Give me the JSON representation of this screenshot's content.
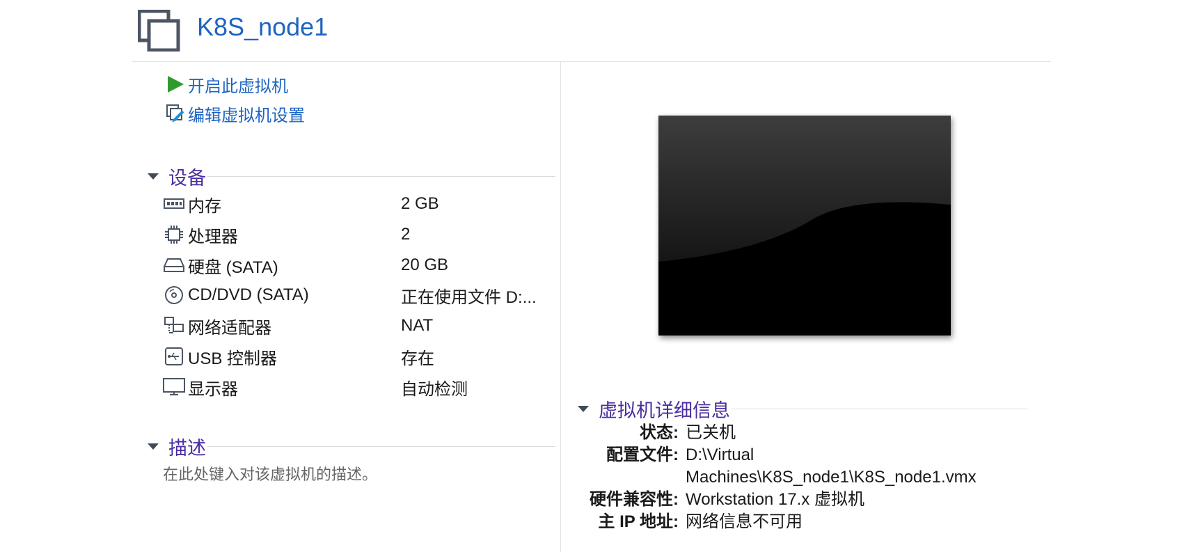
{
  "vm": {
    "title": "K8S_node1"
  },
  "actions": [
    {
      "label": "开启此虚拟机",
      "icon": "play-icon"
    },
    {
      "label": "编辑虚拟机设置",
      "icon": "edit-settings-icon"
    }
  ],
  "devices_section": {
    "title": "设备",
    "items": [
      {
        "name": "内存",
        "value": "2 GB",
        "icon": "memory-icon"
      },
      {
        "name": "处理器",
        "value": "2",
        "icon": "processor-icon"
      },
      {
        "name": "硬盘 (SATA)",
        "value": "20 GB",
        "icon": "hard-disk-icon"
      },
      {
        "name": "CD/DVD (SATA)",
        "value": "正在使用文件 D:...",
        "icon": "cd-dvd-icon"
      },
      {
        "name": "网络适配器",
        "value": "NAT",
        "icon": "network-adapter-icon"
      },
      {
        "name": "USB 控制器",
        "value": "存在",
        "icon": "usb-icon"
      },
      {
        "name": "显示器",
        "value": "自动检测",
        "icon": "display-icon"
      }
    ]
  },
  "description_section": {
    "title": "描述",
    "placeholder": "在此处键入对该虚拟机的描述。"
  },
  "details_section": {
    "title": "虚拟机详细信息",
    "rows": [
      {
        "key": "状态:",
        "value": "已关机"
      },
      {
        "key": "配置文件:",
        "value_line1": "D:\\Virtual",
        "value_line2": "Machines\\K8S_node1\\K8S_node1.vmx"
      },
      {
        "key": "硬件兼容性:",
        "value": "Workstation 17.x 虚拟机"
      },
      {
        "key": "主 IP 地址:",
        "value": "网络信息不可用"
      }
    ]
  },
  "colors": {
    "link": "#1d64c2",
    "section_title": "#4b2da0",
    "play_green": "#2e9b2e"
  }
}
